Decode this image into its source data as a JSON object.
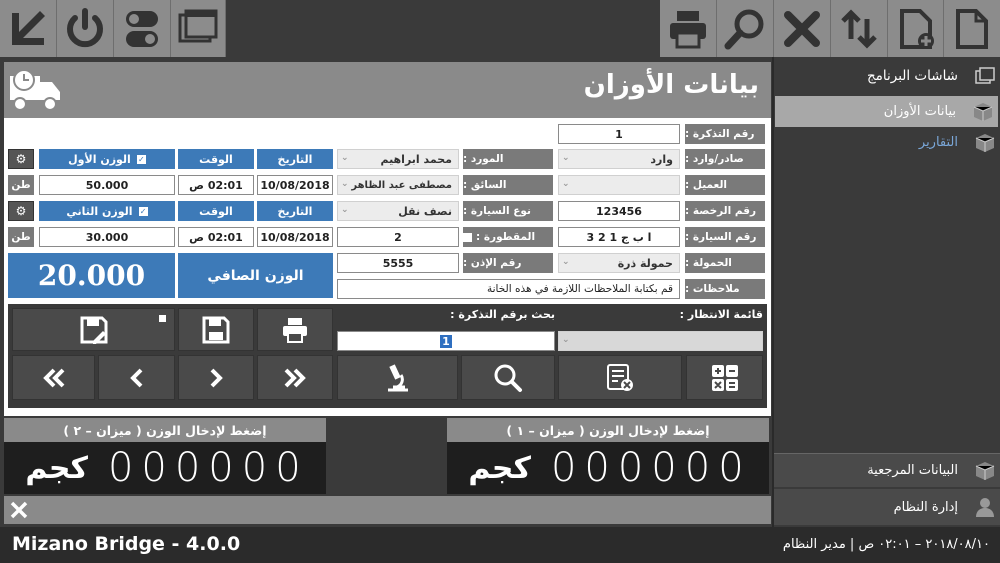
{
  "app": {
    "name": "Mizano Bridge - 4.0.0"
  },
  "status": {
    "text": "٢٠١٨/٠٨/١٠ – ٠٢:٠١ ص | مدير النظام"
  },
  "sidebar": {
    "header": "شاشات البرنامج",
    "items": [
      {
        "label": "بيانات الأوزان"
      },
      {
        "label": "التقارير"
      }
    ],
    "bottom": [
      {
        "label": "البيانات المرجعية"
      },
      {
        "label": "إدارة النظام"
      }
    ]
  },
  "page": {
    "title": "بيانات الأوزان"
  },
  "form": {
    "ticket_label": "رقم التذكرة :",
    "ticket_value": "1",
    "direction_label": "صادر/وارد :",
    "direction_value": "وارد",
    "supplier_label": "المورد :",
    "supplier_value": "محمد ابراهيم",
    "client_label": "العميل :",
    "driver_label": "السائق :",
    "driver_value": "مصطفى عبد الظاهر",
    "license_label": "رقم الرخصة :",
    "license_value": "123456",
    "car_type_label": "نوع السيارة :",
    "car_type_value": "نصف نقل",
    "car_no_label": "رقم السيارة :",
    "car_no_value": "ا ب ج 1 2 3",
    "trailer_label": "المقطورة :",
    "trailer_value": "2",
    "load_label": "الحمولة :",
    "load_value": "حمولة ذرة",
    "permit_label": "رقم الإذن :",
    "permit_value": "5555",
    "notes_label": "ملاحظات :",
    "notes_value": "قم بكتابة الملاحظات اللازمة في هذه الخانة",
    "first_weight_label": "الوزن الأول",
    "second_weight_label": "الوزن الثاني",
    "time_label": "الوقت",
    "date_label": "التاريخ",
    "first_weight": "50.000",
    "first_time": "02:01 ص",
    "first_date": "10/08/2018",
    "second_weight": "30.000",
    "second_time": "02:01 ص",
    "second_date": "10/08/2018",
    "unit": "طن",
    "net_label": "الوزن الصافي",
    "net_value": "20.000"
  },
  "queue": {
    "label": "قائمة الانتظار :",
    "search_label": "بحث برقم التذكرة :",
    "search_value": "1"
  },
  "scales": [
    {
      "title": "( ميزان – ٢ ) إضغط لإدخال الوزن",
      "digits": [
        "0",
        "0",
        "0",
        "0",
        "0",
        "0"
      ],
      "unit": "كجم"
    },
    {
      "title": "( ميزان – ١ ) إضغط لإدخال الوزن",
      "digits": [
        "0",
        "0",
        "0",
        "0",
        "0",
        "0"
      ],
      "unit": "كجم"
    }
  ],
  "colors": {
    "accent": "#3d7ab8",
    "toolbar": "#8c8c8c",
    "dark": "#2b2b2b"
  }
}
